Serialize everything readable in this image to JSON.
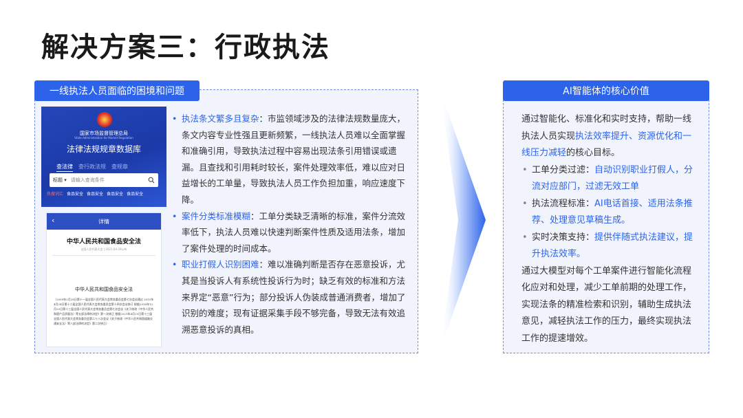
{
  "title": "解决方案三：行政执法",
  "left_header": "一线执法人员面临的困境和问题",
  "right_header": "AI智能体的核心价值",
  "phone1": {
    "agency": "国家市场监督管理总局",
    "agency_en": "State Administration for Market Regulation",
    "db_name": "法律法规规章数据库",
    "tabs": [
      "查法律",
      "查行政法规",
      "查规章"
    ],
    "search_select": "标题",
    "search_placeholder": "请输入查询条件",
    "hot_label": "热搜词汇",
    "hot_items": [
      "食品安全",
      "食品安全",
      "食品安全",
      "食品安全"
    ]
  },
  "phone2": {
    "bar_title": "详情",
    "law_title": "中华人民共和国食品安全法",
    "meta": "全国人民代表大会 | 2021-04-29公布",
    "subtitle": "中华人民共和国食品安全法",
    "body": "（2009年2月28日第十一届全国人民代表大会常务委员会第七次会议通过 2015年4月24日第十二届全国人民代表大会常务委员会第十四次会议修订 根据2018年12月29日第十三届全国人民代表大会常务委员会第七次会议《关于修改〈中华人民共和国产品质量法〉等五部法律的决定》第一次修正 根据2021年4月29日第十三届全国人民代表大会常务委员会第二十八次会议《关于修改〈中华人民共和国道路交通安全法〉等八部法律的决定》第二次修正）"
  },
  "left_items": [
    {
      "head": "执法条文繁多且复杂",
      "body": "：市监领域涉及的法律法规数量庞大，条文内容专业性强且更新频繁，一线执法人员难以全面掌握和准确引用，导致执法过程中容易出现法条引用错误或遗漏。且查找和引用耗时较长，案件处理效率低，难以应对日益增长的工单量，导致执法人员工作负担加重，响应速度下降。"
    },
    {
      "head": "案件分类标准模糊",
      "body": "：工单分类缺乏清晰的标准，案件分流效率低下，执法人员难以快速判断案件性质及适用法条，增加了案件处理的时间成本。"
    },
    {
      "head": "职业打假人识别困难",
      "body": "：难以准确判断是否存在恶意投诉，尤其是当投诉人有系统性投诉行为时；缺乏有效的标准和方法来界定“恶意”行为；部分投诉人伪装成普通消费者，增加了识别的难度；现有证据采集手段不够完备，导致无法有效追溯恶意投诉的真相。"
    }
  ],
  "right": {
    "intro_pre": "通过智能化、标准化和实时支持，帮助一线执法人员实现",
    "intro_hl": "执法效率提升、资源优化和一线压力减轻",
    "intro_post": "的核心目标。",
    "items": [
      {
        "label": "工单分类过滤：",
        "hl": "自动识别职业打假人，分流对应部门，过滤无效工单"
      },
      {
        "label": "执法流程标准：",
        "hl": "AI电话首接、适用法条推荐、处理意见草稿生成。"
      },
      {
        "label": "实时决策支持：",
        "hl": "提供伴随式执法建议，提升执法效率。"
      }
    ],
    "outro": "通过大模型对每个工单案件进行智能化流程化应对和处理，减少工单前期的处理工作，实现法条的精准检索和识别，辅助生成执法意见，减轻执法工作的压力，最终实现执法工作的提速增效。"
  },
  "colors": {
    "accent": "#2d63ea",
    "panel_bg": "#f1f4fd",
    "border": "#6b8fe8"
  }
}
